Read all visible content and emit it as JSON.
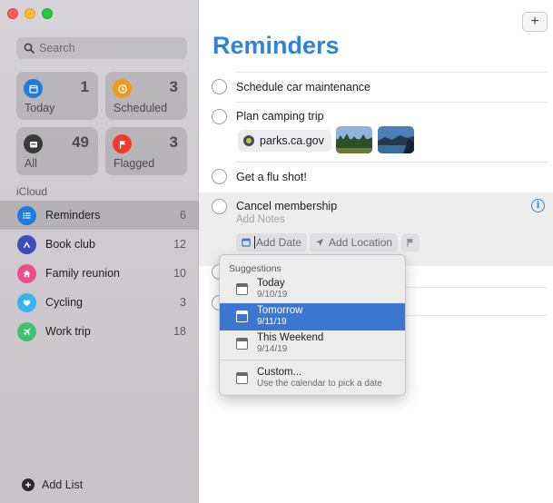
{
  "sidebar": {
    "search_placeholder": "Search",
    "smart_lists": [
      {
        "label": "Today",
        "count": "1",
        "color": "#1e7ce0",
        "icon": "calendar-icon"
      },
      {
        "label": "Scheduled",
        "count": "3",
        "color": "#f09a1c",
        "icon": "clock-icon"
      },
      {
        "label": "All",
        "count": "49",
        "color": "#5b5b5f",
        "icon": "tray-icon"
      },
      {
        "label": "Flagged",
        "count": "3",
        "color": "#ee3b32",
        "icon": "flag-icon"
      }
    ],
    "section": "iCloud",
    "lists": [
      {
        "name": "Reminders",
        "count": "6",
        "color": "#1e7ce0",
        "icon": "list-icon"
      },
      {
        "name": "Book club",
        "count": "12",
        "color": "#3b4fb8",
        "icon": "triangle-icon"
      },
      {
        "name": "Family reunion",
        "count": "10",
        "color": "#ee4b8a",
        "icon": "house-icon"
      },
      {
        "name": "Cycling",
        "count": "3",
        "color": "#35b5f0",
        "icon": "heart-icon"
      },
      {
        "name": "Work trip",
        "count": "18",
        "color": "#3fc06a",
        "icon": "airplane-icon"
      }
    ],
    "add_list": "Add List"
  },
  "main": {
    "add_button": "+",
    "title": "Reminders",
    "accent": "#2f84d6",
    "reminders": [
      {
        "title": "Schedule car maintenance"
      },
      {
        "title": "Plan camping trip",
        "link": "parks.ca.gov"
      },
      {
        "title": "Get a flu shot!"
      },
      {
        "title": "Cancel membership",
        "notes_placeholder": "Add Notes",
        "add_date": "Add Date",
        "add_location": "Add Location"
      }
    ]
  },
  "dropdown": {
    "header": "Suggestions",
    "options": [
      {
        "title": "Today",
        "date": "9/10/19"
      },
      {
        "title": "Tomorrow",
        "date": "9/11/19",
        "highlighted": true
      },
      {
        "title": "This Weekend",
        "date": "9/14/19"
      },
      {
        "title": "Custom...",
        "date": "Use the calendar to pick a date"
      }
    ]
  }
}
